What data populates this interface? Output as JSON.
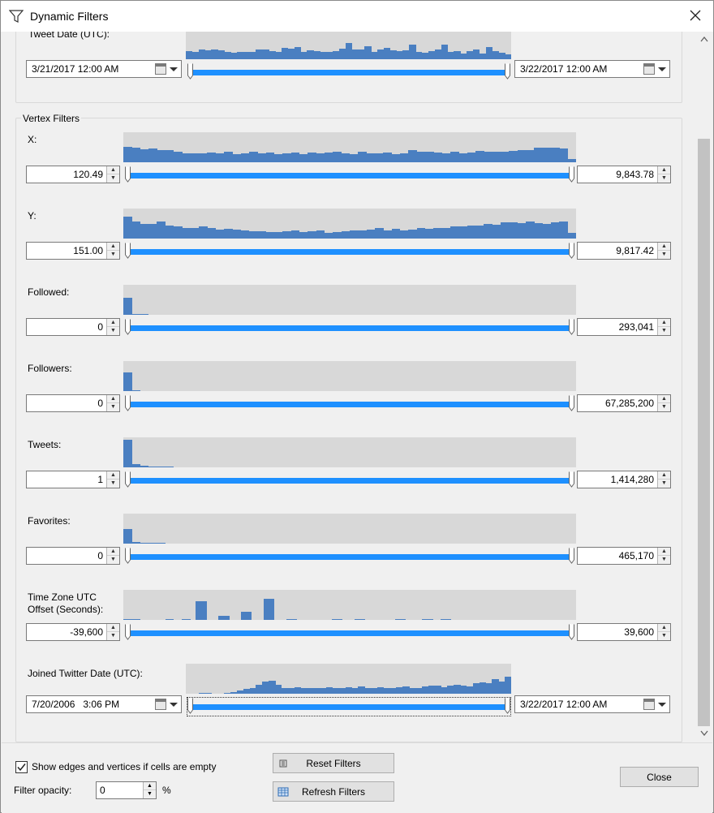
{
  "window": {
    "title": "Dynamic Filters"
  },
  "edge_filters": {
    "tweet_date": {
      "label": "Tweet Date (UTC):",
      "min_value": "3/21/2017 12:00 AM",
      "max_value": "3/22/2017 12:00 AM",
      "histogram": [
        0.3,
        0.28,
        0.35,
        0.32,
        0.34,
        0.32,
        0.26,
        0.24,
        0.28,
        0.26,
        0.28,
        0.36,
        0.34,
        0.3,
        0.28,
        0.4,
        0.38,
        0.44,
        0.28,
        0.32,
        0.3,
        0.26,
        0.26,
        0.3,
        0.38,
        0.58,
        0.36,
        0.34,
        0.46,
        0.28,
        0.36,
        0.4,
        0.32,
        0.3,
        0.32,
        0.52,
        0.28,
        0.24,
        0.3,
        0.36,
        0.52,
        0.28,
        0.3,
        0.2,
        0.3,
        0.36,
        0.2,
        0.44,
        0.3,
        0.24,
        0.18
      ]
    }
  },
  "vertex_filters": {
    "group_label": "Vertex Filters",
    "filters": [
      {
        "label": "X:",
        "min": "120.49",
        "max": "9,843.78",
        "histogram": [
          0.52,
          0.48,
          0.44,
          0.46,
          0.4,
          0.42,
          0.34,
          0.3,
          0.3,
          0.3,
          0.32,
          0.3,
          0.34,
          0.28,
          0.3,
          0.34,
          0.3,
          0.32,
          0.28,
          0.3,
          0.32,
          0.28,
          0.32,
          0.3,
          0.32,
          0.34,
          0.3,
          0.28,
          0.34,
          0.3,
          0.3,
          0.32,
          0.28,
          0.3,
          0.4,
          0.34,
          0.34,
          0.32,
          0.3,
          0.34,
          0.3,
          0.32,
          0.38,
          0.34,
          0.36,
          0.34,
          0.38,
          0.4,
          0.42,
          0.5,
          0.48,
          0.48,
          0.46,
          0.1
        ]
      },
      {
        "label": "Y:",
        "min": "151.00",
        "max": "9,817.42",
        "histogram": [
          0.72,
          0.56,
          0.5,
          0.5,
          0.58,
          0.44,
          0.4,
          0.36,
          0.36,
          0.4,
          0.34,
          0.3,
          0.32,
          0.3,
          0.26,
          0.24,
          0.24,
          0.22,
          0.22,
          0.24,
          0.26,
          0.22,
          0.24,
          0.26,
          0.2,
          0.22,
          0.24,
          0.26,
          0.26,
          0.3,
          0.34,
          0.28,
          0.32,
          0.26,
          0.3,
          0.36,
          0.32,
          0.34,
          0.36,
          0.4,
          0.4,
          0.44,
          0.44,
          0.5,
          0.46,
          0.54,
          0.54,
          0.52,
          0.58,
          0.52,
          0.5,
          0.54,
          0.56,
          0.18
        ]
      },
      {
        "label": "Followed:",
        "min": "0",
        "max": "293,041",
        "histogram": [
          0.58,
          0.04,
          0.01,
          0.0,
          0.0,
          0.0,
          0.0,
          0.0,
          0.0,
          0.0,
          0.0,
          0.0,
          0.0,
          0.0,
          0.0,
          0.0,
          0.0,
          0.0,
          0.0,
          0.0,
          0.0,
          0.0,
          0.0,
          0.0,
          0.0,
          0.0,
          0.0,
          0.0,
          0.0,
          0.0,
          0.0,
          0.0,
          0.0,
          0.0,
          0.0,
          0.0,
          0.0,
          0.0,
          0.0,
          0.0,
          0.0,
          0.0,
          0.0,
          0.0,
          0.0,
          0.0,
          0.0,
          0.0,
          0.0,
          0.0,
          0.0,
          0.0,
          0.0,
          0.0
        ]
      },
      {
        "label": "Followers:",
        "min": "0",
        "max": "67,285,200",
        "histogram": [
          0.62,
          0.02,
          0.0,
          0.0,
          0.0,
          0.0,
          0.0,
          0.0,
          0.0,
          0.0,
          0.0,
          0.0,
          0.0,
          0.0,
          0.0,
          0.0,
          0.0,
          0.0,
          0.0,
          0.0,
          0.0,
          0.0,
          0.0,
          0.0,
          0.0,
          0.0,
          0.0,
          0.0,
          0.0,
          0.0,
          0.0,
          0.0,
          0.0,
          0.0,
          0.0,
          0.0,
          0.0,
          0.0,
          0.0,
          0.0,
          0.0,
          0.0,
          0.0,
          0.0,
          0.0,
          0.0,
          0.0,
          0.0,
          0.0,
          0.0,
          0.0,
          0.0,
          0.0,
          0.0
        ]
      },
      {
        "label": "Tweets:",
        "min": "1",
        "max": "1,414,280",
        "histogram": [
          0.92,
          0.12,
          0.06,
          0.04,
          0.02,
          0.01,
          0.0,
          0.0,
          0.0,
          0.0,
          0.0,
          0.0,
          0.0,
          0.0,
          0.0,
          0.0,
          0.0,
          0.0,
          0.0,
          0.0,
          0.0,
          0.0,
          0.0,
          0.0,
          0.0,
          0.0,
          0.0,
          0.0,
          0.0,
          0.0,
          0.0,
          0.0,
          0.0,
          0.0,
          0.0,
          0.0,
          0.0,
          0.0,
          0.0,
          0.0,
          0.0,
          0.0,
          0.0,
          0.0,
          0.0,
          0.0,
          0.0,
          0.0,
          0.0,
          0.0,
          0.0,
          0.0,
          0.0,
          0.0
        ]
      },
      {
        "label": "Favorites:",
        "min": "0",
        "max": "465,170",
        "histogram": [
          0.48,
          0.06,
          0.03,
          0.02,
          0.01,
          0.0,
          0.0,
          0.0,
          0.0,
          0.0,
          0.0,
          0.0,
          0.0,
          0.0,
          0.0,
          0.0,
          0.0,
          0.0,
          0.0,
          0.0,
          0.0,
          0.0,
          0.0,
          0.0,
          0.0,
          0.0,
          0.0,
          0.0,
          0.0,
          0.0,
          0.0,
          0.0,
          0.0,
          0.0,
          0.0,
          0.0,
          0.0,
          0.0,
          0.0,
          0.0,
          0.0,
          0.0,
          0.0,
          0.0,
          0.0,
          0.0,
          0.0,
          0.0,
          0.0,
          0.0,
          0.0,
          0.0,
          0.0,
          0.0
        ]
      },
      {
        "label": "Time Zone UTC Offset (Seconds):",
        "min": "-39,600",
        "max": "39,600",
        "histogram": [
          0.02,
          0.02,
          0.0,
          0.0,
          0.0,
          0.02,
          0.0,
          0.02,
          0.0,
          0.0,
          0.0,
          0.0,
          0.0,
          0.0,
          0.0,
          0.0,
          0.0,
          0.0,
          0.0,
          0.0,
          0.0,
          0.0,
          0.0,
          0.0,
          0.0,
          0.0,
          0.0,
          0.0,
          0.0,
          0.0,
          0.0,
          0.0,
          0.0,
          0.0,
          0.0,
          0.0,
          0.0,
          0.0,
          0.0,
          0.0,
          0.0,
          0.0,
          0.0,
          0.0,
          0.0,
          0.0,
          0.0,
          0.0,
          0.0,
          0.0,
          0.0,
          0.0,
          0.0,
          0.0
        ],
        "spikes": [
          [
            0.16,
            0.62
          ],
          [
            0.21,
            0.14
          ],
          [
            0.26,
            0.28
          ],
          [
            0.31,
            0.7
          ],
          [
            0.36,
            0.04
          ],
          [
            0.46,
            0.04
          ],
          [
            0.51,
            0.04
          ],
          [
            0.6,
            0.04
          ],
          [
            0.66,
            0.04
          ],
          [
            0.7,
            0.04
          ]
        ]
      },
      {
        "label": "Joined Twitter Date (UTC):",
        "min": "7/20/2006   3:06 PM",
        "max": "3/22/2017 12:00 AM",
        "is_date": true,
        "histogram": [
          0.0,
          0.0,
          0.04,
          0.02,
          0.0,
          0.0,
          0.04,
          0.06,
          0.1,
          0.16,
          0.18,
          0.3,
          0.42,
          0.44,
          0.3,
          0.2,
          0.18,
          0.22,
          0.2,
          0.18,
          0.2,
          0.18,
          0.22,
          0.2,
          0.2,
          0.22,
          0.18,
          0.24,
          0.2,
          0.18,
          0.22,
          0.18,
          0.2,
          0.22,
          0.24,
          0.2,
          0.2,
          0.24,
          0.28,
          0.26,
          0.22,
          0.26,
          0.3,
          0.28,
          0.24,
          0.34,
          0.38,
          0.36,
          0.5,
          0.4,
          0.56
        ]
      }
    ]
  },
  "bottom": {
    "show_empty_label": "Show edges and vertices if cells are empty",
    "show_empty_checked": true,
    "opacity_label": "Filter opacity:",
    "opacity_value": "0",
    "opacity_unit": "%",
    "reset_label": "Reset Filters",
    "refresh_label": "Refresh Filters",
    "close_label": "Close"
  },
  "colors": {
    "histogram_bar": "#4a7fc1",
    "histogram_bg": "#d8d8d8",
    "slider_track": "#1e90ff"
  },
  "icons": [
    "filter-icon",
    "close-icon",
    "calendar-icon",
    "dropdown-arrow-icon",
    "spin-up-icon",
    "spin-down-icon",
    "reset-icon",
    "refresh-icon",
    "scroll-up-icon",
    "scroll-down-icon"
  ]
}
